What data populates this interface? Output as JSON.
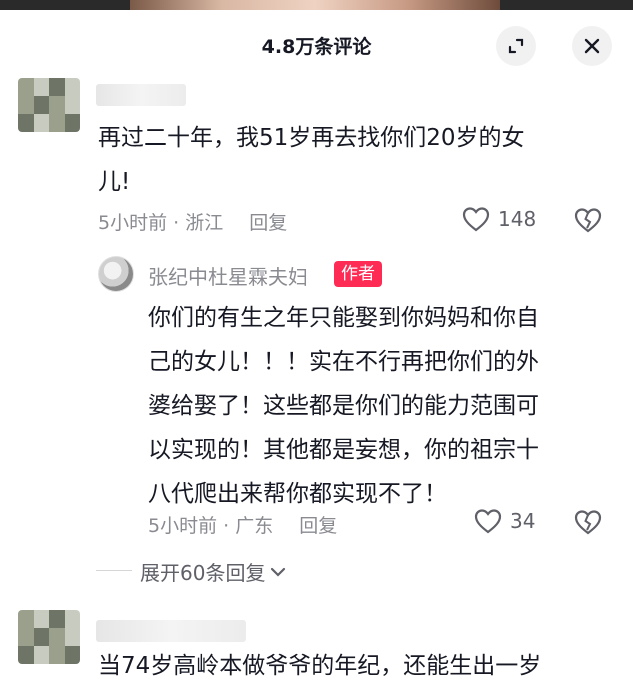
{
  "header": {
    "title": "4.8万条评论"
  },
  "comments": [
    {
      "text_line1": "再过二十年，我51岁再去找你们20岁的女",
      "text_line2": "儿!",
      "time_location": "5小时前 · 浙江",
      "reply_label": "回复",
      "like_count": "148",
      "replies": [
        {
          "author": "张纪中杜星霖夫妇",
          "badge": "作者",
          "lines": [
            "你们的有生之年只能娶到你妈妈和你自",
            "己的女儿！！！实在不行再把你们的外",
            "婆给娶了！这些都是你们的能力范围可",
            "以实现的！其他都是妄想，你的祖宗十",
            "八代爬出来帮你都实现不了！"
          ],
          "time_location": "5小时前 · 广东",
          "reply_label": "回复",
          "like_count": "34"
        }
      ],
      "expand_label": "展开60条回复"
    },
    {
      "text_line1": "当74岁高岭本做爷爷的年纪，还能生出一岁"
    }
  ],
  "colors": {
    "accent": "#fe2c55",
    "meta": "#8a8b91",
    "text": "#161823"
  }
}
